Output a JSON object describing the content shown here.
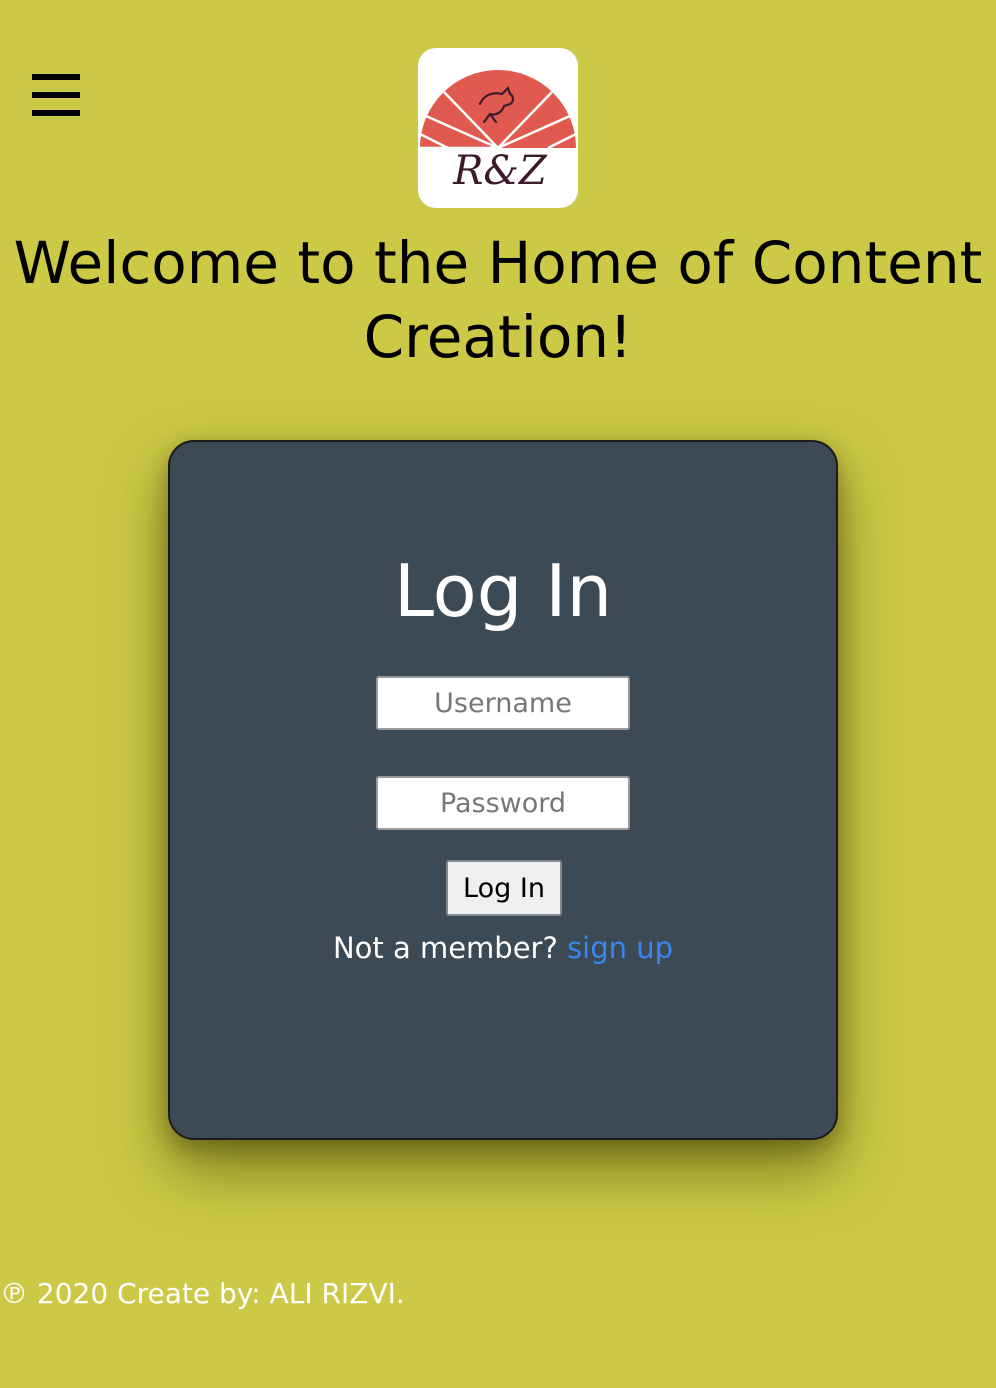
{
  "header": {
    "menu_icon": "hamburger-menu-icon",
    "logo_text": "R&Z"
  },
  "welcome": {
    "title": "Welcome to the Home of Content Creation!"
  },
  "login": {
    "title": "Log In",
    "username_placeholder": "Username",
    "password_placeholder": "Password",
    "button_label": "Log In",
    "signup_prompt": "Not a member?",
    "signup_link": "sign up"
  },
  "footer": {
    "text": "℗ 2020 Create by: ALI RIZVI."
  },
  "colors": {
    "background": "#cbc945",
    "card": "#3c4a55",
    "link": "#3a86f0",
    "logo_red": "#e15a4f"
  }
}
